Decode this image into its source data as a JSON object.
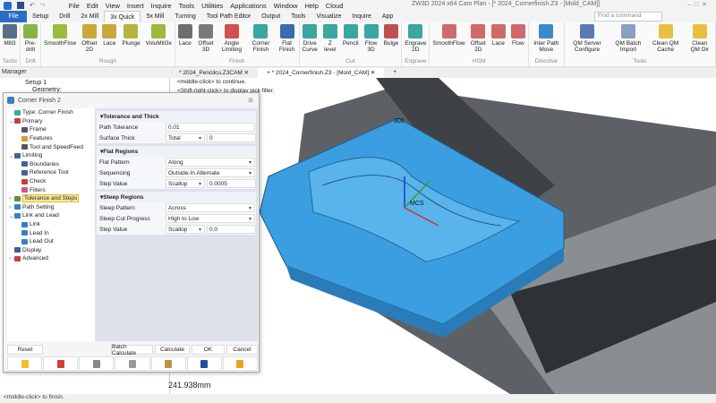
{
  "menu": [
    "File",
    "Edit",
    "View",
    "Insert",
    "Inquire",
    "Tools",
    "Utilities",
    "Applications",
    "Window",
    "Help",
    "Cloud"
  ],
  "title": "ZW3D 2024  x64        Cam Plan - [* 2024_Cornerfinish.Z3 - [Mold_CAM]]",
  "search_placeholder": "Find a command",
  "tabs": [
    "File",
    "Setup",
    "Drill",
    "2x Mill",
    "3x Quick",
    "5x Mill",
    "Turning",
    "Tool Path Editor",
    "Output",
    "Tools",
    "Visualize",
    "Inquire",
    "App"
  ],
  "active_tab": "3x Quick",
  "ribbon": [
    {
      "group": "Tactic",
      "buttons": [
        {
          "label": "Mill3",
          "color": "#5a6e8c"
        }
      ]
    },
    {
      "group": "Drill",
      "buttons": [
        {
          "label": "Pre-drill",
          "color": "#8bb24a"
        }
      ]
    },
    {
      "group": "Rough",
      "buttons": [
        {
          "label": "SmoothFlow",
          "color": "#9cba3c"
        },
        {
          "label": "Offset 2D",
          "color": "#c9a83c"
        },
        {
          "label": "Lace",
          "color": "#c9a83c"
        },
        {
          "label": "Plunge",
          "color": "#b5b43c"
        },
        {
          "label": "VoluMill3x",
          "color": "#9cba3c"
        }
      ]
    },
    {
      "group": "Finish",
      "buttons": [
        {
          "label": "Lace",
          "color": "#6e6e6e"
        },
        {
          "label": "Offset 3D",
          "color": "#7a7a7a"
        },
        {
          "label": "Angle Limiting",
          "color": "#d05050"
        },
        {
          "label": "Corner Finish",
          "color": "#3aa7a0"
        },
        {
          "label": "Flat Finish",
          "color": "#3a6ab0"
        }
      ]
    },
    {
      "group": "Cut",
      "buttons": [
        {
          "label": "Drive Curve",
          "color": "#3aa7a0"
        },
        {
          "label": "Z level",
          "color": "#3aa7a0"
        },
        {
          "label": "Pencil",
          "color": "#3aa7a0"
        },
        {
          "label": "Flow 3D",
          "color": "#3aa7a0"
        },
        {
          "label": "Bulge",
          "color": "#c05050"
        }
      ]
    },
    {
      "group": "Engrave",
      "buttons": [
        {
          "label": "Engrave 2D",
          "color": "#3aa7a0"
        }
      ]
    },
    {
      "group": "HSM",
      "buttons": [
        {
          "label": "SmoothFlow",
          "color": "#d06a6a"
        },
        {
          "label": "Offset 2D",
          "color": "#d06a6a"
        },
        {
          "label": "Lace",
          "color": "#d06a6a"
        },
        {
          "label": "Flow",
          "color": "#d06a6a"
        }
      ]
    },
    {
      "group": "Directive",
      "buttons": [
        {
          "label": "Inter Path Move",
          "color": "#3a8ad0"
        }
      ]
    },
    {
      "group": "Tools",
      "buttons": [
        {
          "label": "QM Server Configure",
          "color": "#5a7ab0"
        },
        {
          "label": "QM Batch Import",
          "color": "#8aa0c0"
        },
        {
          "label": "Clean QM Cache",
          "color": "#e8c040"
        },
        {
          "label": "Clean QM Dir",
          "color": "#e8c040"
        }
      ]
    }
  ],
  "manager": {
    "title": "Manager",
    "items": [
      "Setup 1",
      "Geometry:"
    ]
  },
  "doc_tabs": [
    "* 2024_Pencilcu.Z3CAM ✕",
    "+ * 2024_Cornerfinish.Z3 - [Mold_CAM] ✕",
    "+"
  ],
  "hints": [
    "<middle-click> to continue.",
    "<Shift-right-click> to display pick filter."
  ],
  "viewport": {
    "label": "300",
    "axis_label": "MCS"
  },
  "dialog": {
    "title": "Corner Finish 2",
    "tree": [
      {
        "label": "Type: Corner Finish",
        "indent": 0,
        "color": "#3aa7a0"
      },
      {
        "label": "Primary",
        "indent": 0,
        "color": "#c04040",
        "exp": "v"
      },
      {
        "label": "Frame",
        "indent": 1,
        "color": "#556"
      },
      {
        "label": "Features",
        "indent": 1,
        "color": "#d0a030"
      },
      {
        "label": "Tool and SpeedFeed",
        "indent": 1,
        "color": "#556"
      },
      {
        "label": "Limiting",
        "indent": 0,
        "color": "#4060a0",
        "exp": "v"
      },
      {
        "label": "Boundaries",
        "indent": 1,
        "color": "#4060a0"
      },
      {
        "label": "Reference Tool",
        "indent": 1,
        "color": "#4060a0"
      },
      {
        "label": "Check",
        "indent": 1,
        "color": "#c04040"
      },
      {
        "label": "Filters",
        "indent": 1,
        "color": "#c06080"
      },
      {
        "label": "Tolerance and Steps",
        "indent": 0,
        "color": "#6a8a40",
        "exp": ">",
        "selected": true
      },
      {
        "label": "Path Setting",
        "indent": 0,
        "color": "#3a80c0",
        "exp": ">"
      },
      {
        "label": "Link and Lead",
        "indent": 0,
        "color": "#3a80c0",
        "exp": "v"
      },
      {
        "label": "Link",
        "indent": 1,
        "color": "#3a80c0"
      },
      {
        "label": "Lead In",
        "indent": 1,
        "color": "#3a80c0"
      },
      {
        "label": "Lead Out",
        "indent": 1,
        "color": "#3a80c0"
      },
      {
        "label": "Display",
        "indent": 0,
        "color": "#3a60a0"
      },
      {
        "label": "Advanced",
        "indent": 0,
        "color": "#c04040",
        "exp": ">"
      }
    ],
    "sections": [
      {
        "title": "Tolerance and Thick",
        "rows": [
          {
            "label": "Path Tolerance",
            "value": "0.01"
          },
          {
            "label": "Surface Thick",
            "select": "Total",
            "value": "0"
          }
        ]
      },
      {
        "title": "Flat Regions",
        "rows": [
          {
            "label": "Flat Pattern",
            "dropdown": "Along"
          },
          {
            "label": "Sequencing",
            "dropdown": "Outside-In Alternate"
          },
          {
            "label": "Step Value",
            "select": "Scallop",
            "value": "0.0005"
          }
        ]
      },
      {
        "title": "Steep Regions",
        "rows": [
          {
            "label": "Steep Pattern",
            "dropdown": "Across"
          },
          {
            "label": "Steep Cut Progress",
            "dropdown": "High to Low"
          },
          {
            "label": "Step Value",
            "select": "Scallop",
            "value": "0.0"
          }
        ]
      }
    ],
    "buttons": {
      "reset": "Reset",
      "batch": "Batch Calculate",
      "calculate": "Calculate",
      "ok": "OK",
      "cancel": "Cancel"
    },
    "icon_buttons": [
      {
        "name": "lightbulb-icon",
        "color": "#f0c020"
      },
      {
        "name": "edit-icon",
        "color": "#d04030"
      },
      {
        "name": "toolpath-icon",
        "color": "#888"
      },
      {
        "name": "machine-icon",
        "color": "#999"
      },
      {
        "name": "tool-icon",
        "color": "#c09040"
      },
      {
        "name": "save-icon",
        "color": "#2050a0"
      },
      {
        "name": "folder-icon",
        "color": "#f0a020"
      }
    ]
  },
  "measure": "241.938mm",
  "status": "<middle-click> to finish.",
  "colors": {
    "accent": "#2b6cc4",
    "part": "#3a9ee0",
    "fixture": "#6a6e72"
  }
}
